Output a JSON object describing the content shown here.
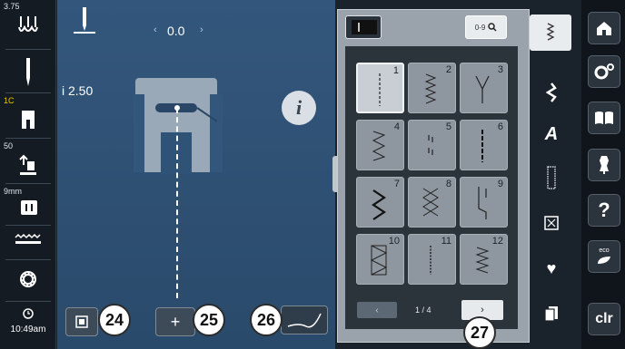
{
  "left_bar": {
    "tension": "3.75",
    "presser_foot": "1C",
    "thread_value": "50",
    "width_value": "9mm",
    "time": "10:49am"
  },
  "main": {
    "needle_position": "0.0",
    "stitch_width": "2.50",
    "info_label": "i"
  },
  "selection": {
    "search_label": "0-9",
    "stitches": [
      {
        "num": "1",
        "kind": "straight"
      },
      {
        "num": "2",
        "kind": "zigzag-stitched"
      },
      {
        "num": "3",
        "kind": "vari-overlock"
      },
      {
        "num": "4",
        "kind": "zigzag-3step"
      },
      {
        "num": "5",
        "kind": "running"
      },
      {
        "num": "6",
        "kind": "triple-straight"
      },
      {
        "num": "7",
        "kind": "triple-zigzag"
      },
      {
        "num": "8",
        "kind": "honeycomb"
      },
      {
        "num": "9",
        "kind": "blindstitch"
      },
      {
        "num": "10",
        "kind": "double-overlock"
      },
      {
        "num": "11",
        "kind": "superstretch"
      },
      {
        "num": "12",
        "kind": "gathering"
      }
    ],
    "page": "1 / 4"
  },
  "callouts": {
    "c24": "24",
    "c25": "25",
    "c26": "26",
    "c27": "27"
  },
  "right_bar": {
    "clr_label": "clr",
    "eco_label": "eco",
    "help_label": "?"
  }
}
